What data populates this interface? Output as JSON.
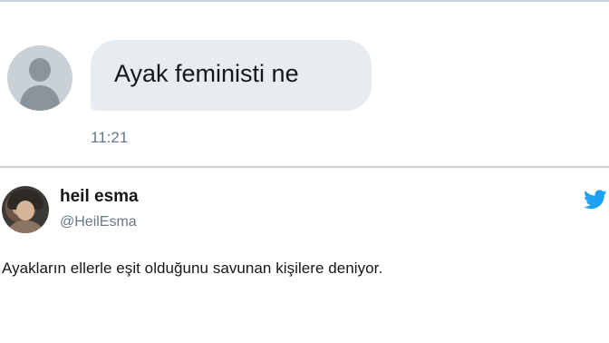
{
  "dm": {
    "message": "Ayak feministi ne",
    "time": "11:21"
  },
  "tweet": {
    "name": "heil esma",
    "handle": "@HeilEsma",
    "text": "Ayakların ellerle eşit olduğunu savunan kişilere deniyor."
  },
  "icons": {
    "dm_avatar": "default-user-avatar-icon",
    "tweet_brand": "twitter-bird-icon"
  },
  "colors": {
    "bubble": "#e6ecf0",
    "secondary_text": "#657786",
    "twitter_blue": "#1da1f2",
    "divider": "#c7d3dc"
  }
}
